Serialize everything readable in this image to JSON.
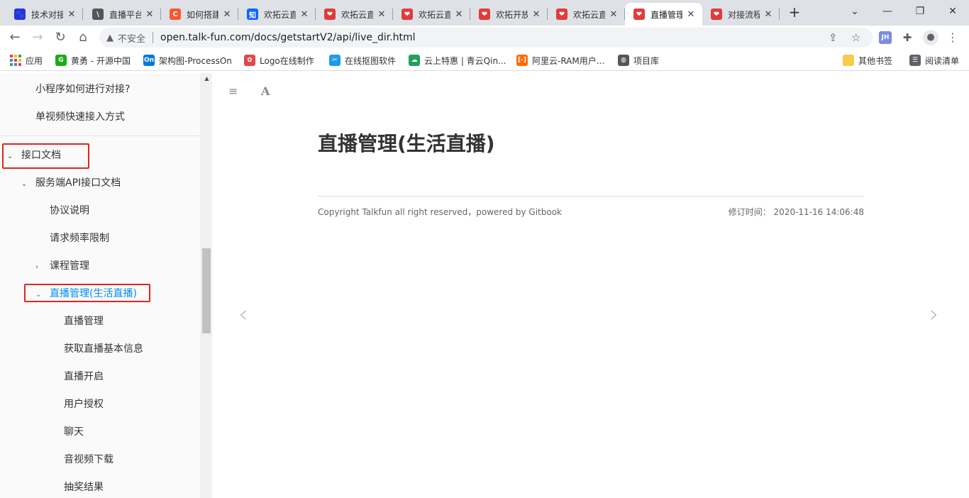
{
  "tabs": [
    {
      "title": "技术对接",
      "icon": "baidu-paw",
      "icon_color": "#2932e1",
      "icon_glyph": "🐾"
    },
    {
      "title": "直播平台",
      "icon": "feather",
      "icon_color": "#555555",
      "icon_glyph": "\\"
    },
    {
      "title": "如何搭建",
      "icon": "csdn-c",
      "icon_color": "#fc5531",
      "icon_glyph": "C"
    },
    {
      "title": "欢拓云直",
      "icon": "zhihu-zhi",
      "icon_color": "#0a66ff",
      "icon_glyph": "知"
    },
    {
      "title": "欢拓云直",
      "icon": "talkfun",
      "icon_color": "#e23b3b",
      "icon_glyph": "❤"
    },
    {
      "title": "欢拓云直",
      "icon": "talkfun",
      "icon_color": "#e23b3b",
      "icon_glyph": "❤"
    },
    {
      "title": "欢拓开放",
      "icon": "talkfun",
      "icon_color": "#e23b3b",
      "icon_glyph": "❤"
    },
    {
      "title": "欢拓云直",
      "icon": "talkfun",
      "icon_color": "#e23b3b",
      "icon_glyph": "❤"
    },
    {
      "title": "直播管理",
      "icon": "talkfun",
      "icon_color": "#e23b3b",
      "icon_glyph": "❤",
      "active": true
    },
    {
      "title": "对接流程",
      "icon": "talkfun",
      "icon_color": "#e23b3b",
      "icon_glyph": "❤"
    }
  ],
  "toolbar": {
    "insecure_label": "不安全",
    "url": "open.talk-fun.com/docs/getstartV2/api/live_dir.html",
    "ext_jh_label": "JH"
  },
  "bookmarks": [
    {
      "label": "应用",
      "icon": "apps-grid-icon"
    },
    {
      "label": "黄勇 - 开源中国",
      "icon": "oschina-icon",
      "color": "#1aad19",
      "glyph": "G"
    },
    {
      "label": "架构图-ProcessOn",
      "icon": "processon-icon",
      "color": "#0678d7",
      "glyph": "On"
    },
    {
      "label": "Logo在线制作",
      "icon": "logo-maker-icon",
      "color": "#e0484b",
      "glyph": "✿"
    },
    {
      "label": "在线抠图软件",
      "icon": "koutu-icon",
      "color": "#1e9be8",
      "glyph": "✂"
    },
    {
      "label": "云上特惠 | 青云Qin...",
      "icon": "qingcloud-icon",
      "color": "#21a05b",
      "glyph": "☁"
    },
    {
      "label": "阿里云-RAM用户...",
      "icon": "aliyun-icon",
      "color": "#ff6a00",
      "glyph": "[-]"
    },
    {
      "label": "项目库",
      "icon": "globe-icon",
      "color": "#555555",
      "glyph": "◍"
    },
    {
      "label": "其他书签",
      "icon": "folder-icon",
      "color": "#f7cc4a",
      "glyph": ""
    },
    {
      "label": "阅读清单",
      "icon": "reading-list-icon",
      "color": "#5f6368",
      "glyph": "☰"
    }
  ],
  "sidebar": {
    "items": [
      {
        "label": "小程序如何进行对接?",
        "level": 1
      },
      {
        "label": "单视频快速接入方式",
        "level": 1
      },
      {
        "label": "接口文档",
        "level": 0,
        "expanded": true
      },
      {
        "label": "服务端API接口文档",
        "level": 1,
        "expanded": true
      },
      {
        "label": "协议说明",
        "level": 2
      },
      {
        "label": "请求频率限制",
        "level": 2
      },
      {
        "label": "课程管理",
        "level": 2,
        "collapsed": true
      },
      {
        "label": "直播管理(生活直播)",
        "level": 2,
        "expanded": true,
        "active": true
      },
      {
        "label": "直播管理",
        "level": 3
      },
      {
        "label": "获取直播基本信息",
        "level": 3
      },
      {
        "label": "直播开启",
        "level": 3
      },
      {
        "label": "用户授权",
        "level": 3
      },
      {
        "label": "聊天",
        "level": 3
      },
      {
        "label": "音视频下载",
        "level": 3
      },
      {
        "label": "抽奖结果",
        "level": 3
      }
    ]
  },
  "main": {
    "title": "直播管理(生活直播)",
    "copyright": "Copyright Talkfun all right reserved，powered by Gitbook",
    "revised_label": "修订时间：",
    "revised_time": "2020-11-16 14:06:48",
    "font_button": "A"
  },
  "colors": {
    "link_active": "#008cff",
    "highlight_box": "#e1251b"
  }
}
